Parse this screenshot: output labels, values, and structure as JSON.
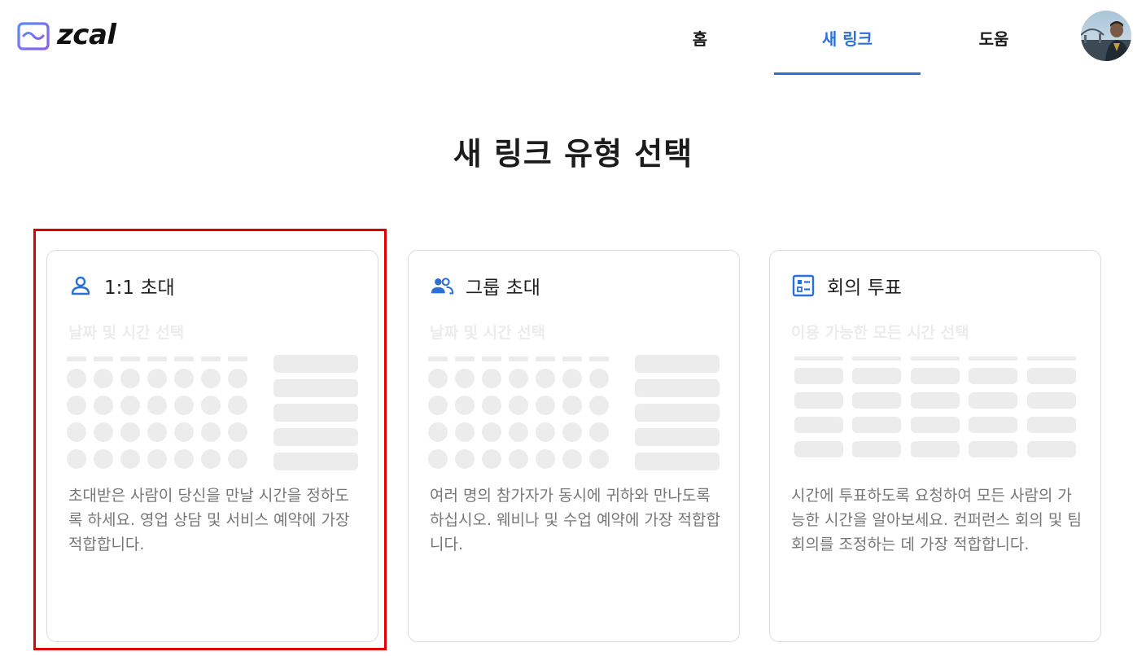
{
  "app": {
    "logo_text": "zcal",
    "brand_color": "#6b5cf0",
    "accent": "#2b6fd8"
  },
  "nav": {
    "items": [
      {
        "label": "홈",
        "active": false
      },
      {
        "label": "새 링크",
        "active": true
      },
      {
        "label": "도움",
        "active": false
      }
    ]
  },
  "page": {
    "title": "새 링크 유형 선택"
  },
  "cards": [
    {
      "icon": "person-icon",
      "title": "1:1 초대",
      "subtitle": "날짜 및 시간 선택",
      "description": "초대받은 사람이 당신을 만날 시간을 정하도록 하세요. 영업 상담 및 서비스 예약에 가장 적합합니다.",
      "selected": true
    },
    {
      "icon": "group-icon",
      "title": "그룹 초대",
      "subtitle": "날짜 및 시간 선택",
      "description": "여러 명의 참가자가 동시에 귀하와 만나도록 하십시오. 웨비나 및 수업 예약에 가장 적합합니다.",
      "selected": false
    },
    {
      "icon": "poll-icon",
      "title": "회의 투표",
      "subtitle": "이용 가능한 모든 시간 선택",
      "description": "시간에 투표하도록 요청하여 모든 사람의 가능한 시간을 알아보세요. 컨퍼런스 회의 및 팀 회의를 조정하는 데 가장 적합합니다.",
      "selected": false
    }
  ]
}
